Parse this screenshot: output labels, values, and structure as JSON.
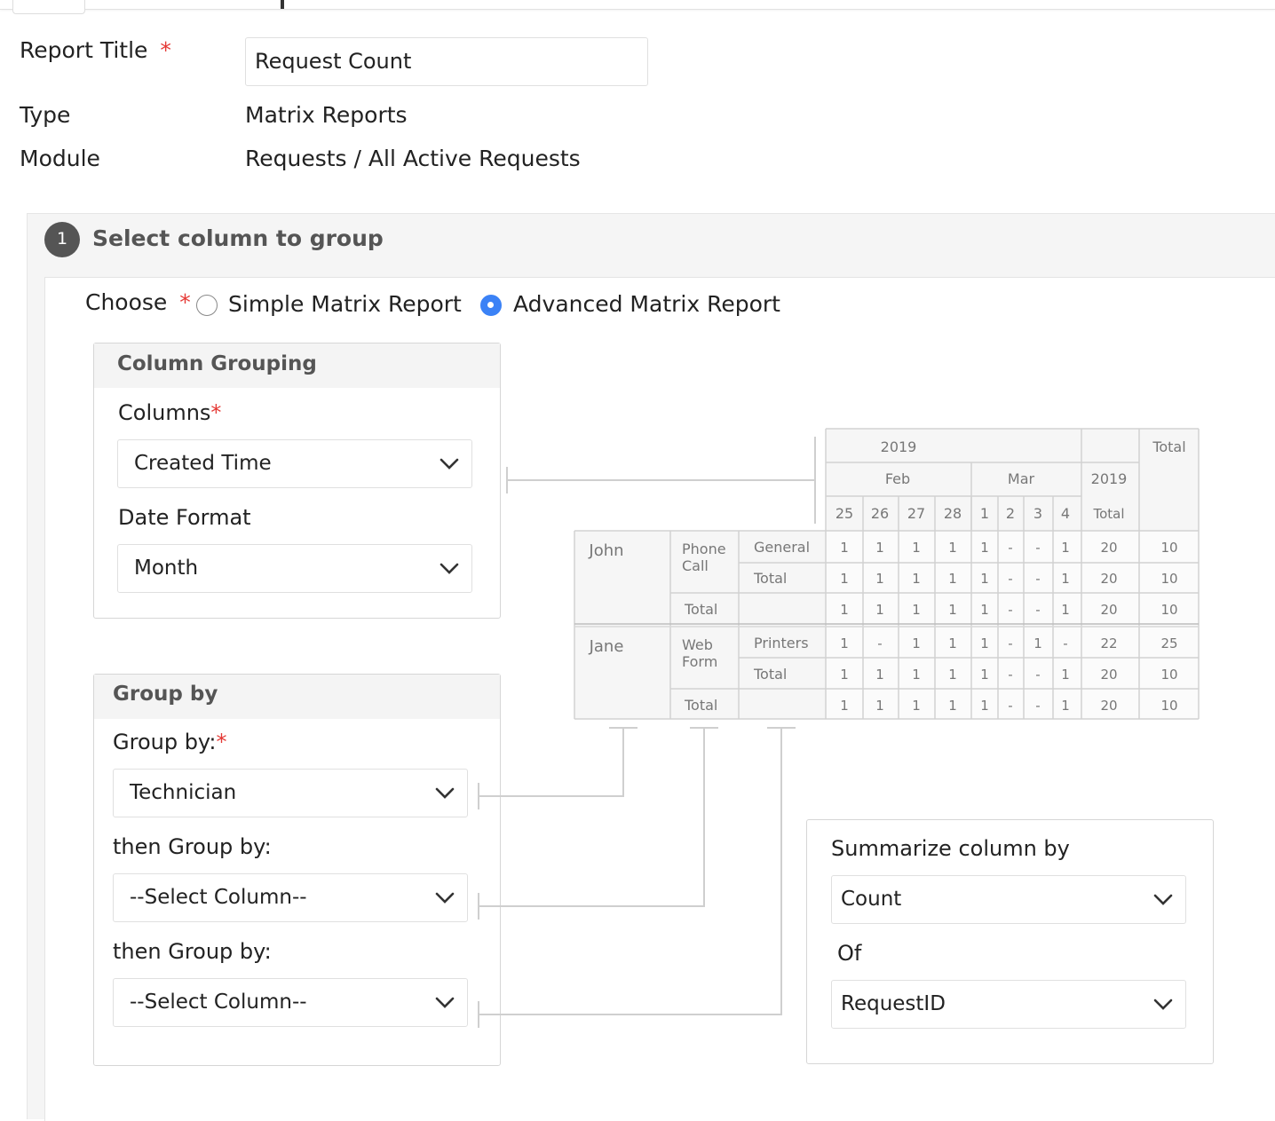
{
  "form": {
    "report_title_label": "Report Title",
    "required_mark": "*",
    "report_title_value": "Request Count",
    "type_label": "Type",
    "type_value": "Matrix Reports",
    "module_label": "Module",
    "module_value": "Requests / All Active Requests"
  },
  "step": {
    "number": "1",
    "title": "Select column to group"
  },
  "choose": {
    "label": "Choose",
    "options": [
      "Simple Matrix Report",
      "Advanced Matrix Report"
    ],
    "selected": "Advanced Matrix Report"
  },
  "column_grouping": {
    "header": "Column Grouping",
    "columns_label": "Columns",
    "columns_value": "Created Time",
    "date_format_label": "Date Format",
    "date_format_value": "Month"
  },
  "group_by": {
    "header": "Group by",
    "group_by_label": "Group by:",
    "group_by_value": "Technician",
    "then_label_1": "then Group by:",
    "then_value_1": "--Select Column--",
    "then_label_2": "then Group by:",
    "then_value_2": "--Select Column--"
  },
  "summarize": {
    "header": "Summarize column by",
    "value": "Count",
    "of_label": "Of",
    "of_value": "RequestID"
  },
  "preview": {
    "year": "2019",
    "total": "Total",
    "months": [
      "Feb",
      "Mar"
    ],
    "year_total_top": "2019",
    "year_total_bottom": "Total",
    "days": [
      "25",
      "26",
      "27",
      "28",
      "1",
      "2",
      "3",
      "4"
    ],
    "groups": [
      {
        "name": "John",
        "sub": [
          "Phone",
          "Call"
        ],
        "rows": [
          {
            "label": "General",
            "cells": [
              "1",
              "1",
              "1",
              "1",
              "1",
              "-",
              "-",
              "1"
            ],
            "yt": "20",
            "tot": "10"
          },
          {
            "label": "Total",
            "cells": [
              "1",
              "1",
              "1",
              "1",
              "1",
              "-",
              "-",
              "1"
            ],
            "yt": "20",
            "tot": "10"
          }
        ],
        "total_row": {
          "label": "Total",
          "cells": [
            "1",
            "1",
            "1",
            "1",
            "1",
            "-",
            "-",
            "1"
          ],
          "yt": "20",
          "tot": "10"
        }
      },
      {
        "name": "Jane",
        "sub": [
          "Web",
          "Form"
        ],
        "rows": [
          {
            "label": "Printers",
            "cells": [
              "1",
              "-",
              "1",
              "1",
              "1",
              "-",
              "1",
              "-"
            ],
            "yt": "22",
            "tot": "25"
          },
          {
            "label": "Total",
            "cells": [
              "1",
              "1",
              "1",
              "1",
              "1",
              "-",
              "-",
              "1"
            ],
            "yt": "20",
            "tot": "10"
          }
        ],
        "total_row": {
          "label": "Total",
          "cells": [
            "1",
            "1",
            "1",
            "1",
            "1",
            "-",
            "-",
            "1"
          ],
          "yt": "20",
          "tot": "10"
        }
      }
    ]
  }
}
